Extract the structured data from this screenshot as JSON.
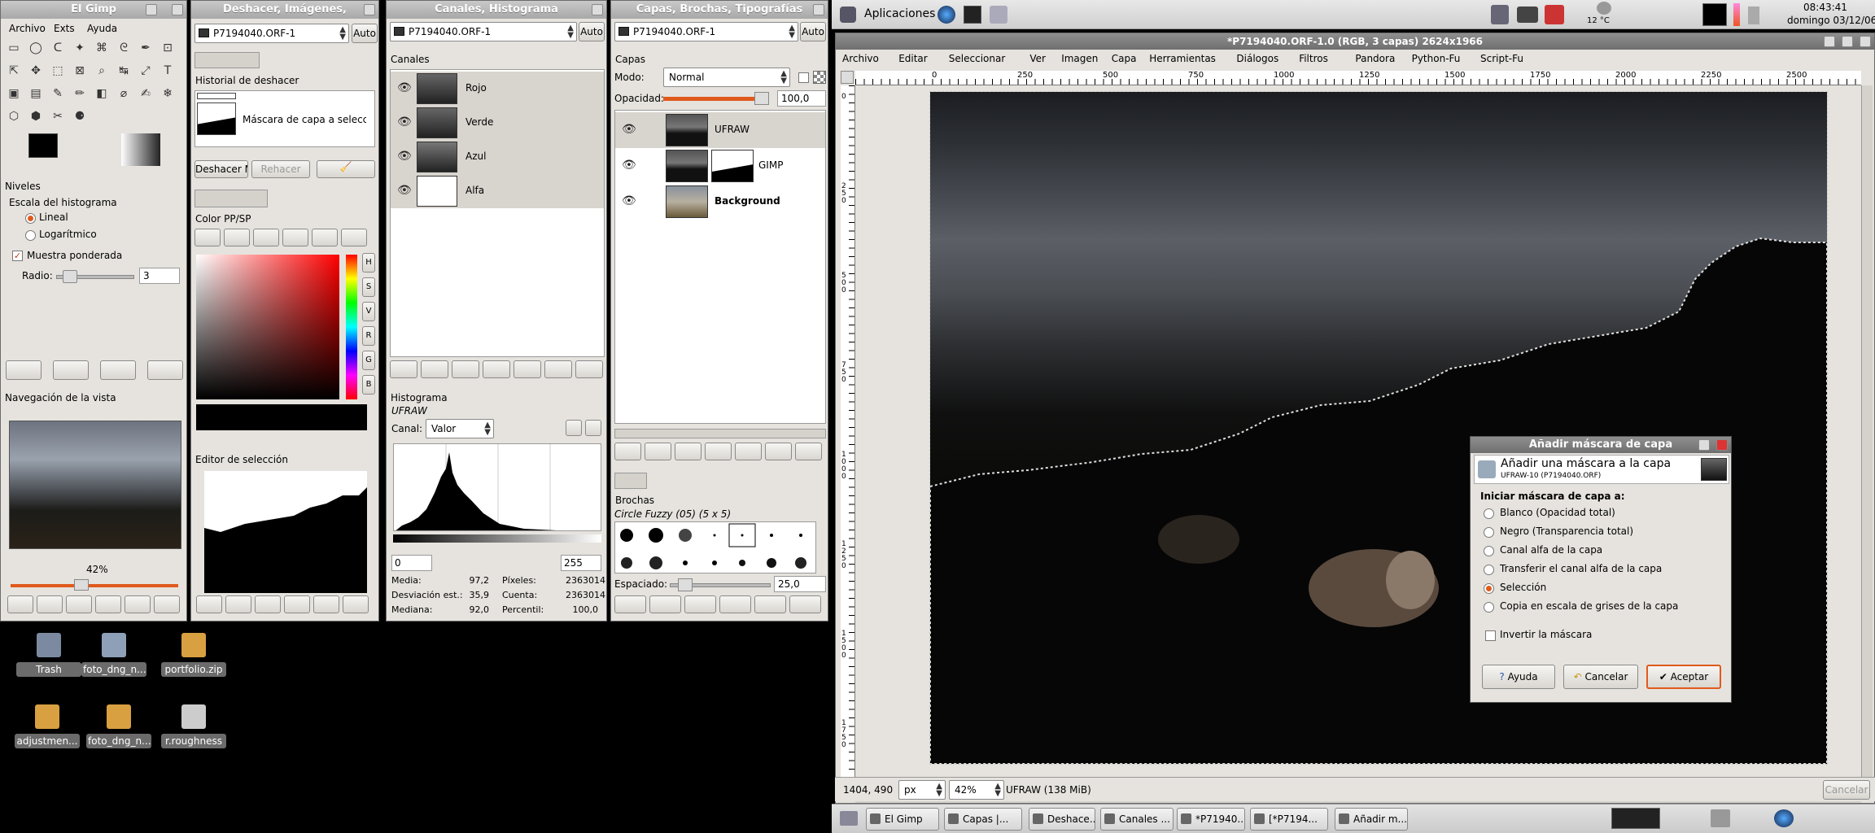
{
  "toolbox": {
    "title": "El Gimp",
    "menu": [
      "Archivo",
      "Exts",
      "Ayuda"
    ],
    "levels": {
      "title": "Niveles",
      "scale_label": "Escala del histograma",
      "linear": "Lineal",
      "log": "Logarítmico",
      "weighted": "Muestra ponderada",
      "radius_label": "Radio:",
      "radius_value": "3"
    },
    "nav": {
      "title": "Navegación de la vista",
      "zoom": "42%"
    }
  },
  "undo": {
    "title": "Deshacer, Imágenes,",
    "image": "P7194040.ORF-1",
    "auto": "Auto",
    "hist_title": "Historial de deshacer",
    "hist_item": "Máscara de capa a selección",
    "undo_btn": "Deshacer M",
    "redo_btn": "Rehacer",
    "color_title": "Color PP/SP",
    "letters": [
      "H",
      "S",
      "V",
      "R",
      "G",
      "B"
    ],
    "sel_title": "Editor de selección"
  },
  "channels": {
    "title": "Canales, Histograma",
    "image": "P7194040.ORF-1",
    "auto": "Auto",
    "section": "Canales",
    "items": [
      "Rojo",
      "Verde",
      "Azul",
      "Alfa"
    ],
    "hist": {
      "title": "Histograma",
      "layer": "UFRAW",
      "channel_label": "Canal:",
      "channel": "Valor",
      "from": "0",
      "to": "255",
      "stats": [
        [
          "Media:",
          "97,2"
        ],
        [
          "Píxeles:",
          "2363014"
        ],
        [
          "Desviación est.:",
          "35,9"
        ],
        [
          "Cuenta:",
          "2363014"
        ],
        [
          "Mediana:",
          "92,0"
        ],
        [
          "Percentil:",
          "100,0"
        ]
      ]
    }
  },
  "layers": {
    "title": "Capas, Brochas, Tipografías",
    "image": "P7194040.ORF-1",
    "auto": "Auto",
    "section": "Capas",
    "mode_label": "Modo:",
    "mode": "Normal",
    "opacity_label": "Opacidad:",
    "opacity": "100,0",
    "items": [
      "UFRAW",
      "GIMP",
      "Background"
    ],
    "brushes": {
      "title": "Brochas",
      "name": "Circle Fuzzy (05) (5 x 5)",
      "spacing_label": "Espaciado:",
      "spacing": "25,0"
    }
  },
  "panel": {
    "apps": "Aplicaciones",
    "temp": "12 °C",
    "time": "08:43:41",
    "date": "domingo 03/12/06"
  },
  "image": {
    "title": "*P7194040.ORF-1.0 (RGB, 3 capas) 2624x1966",
    "menu": [
      "Archivo",
      "Editar",
      "Seleccionar",
      "Ver",
      "Imagen",
      "Capa",
      "Herramientas",
      "Diálogos",
      "Filtros",
      "Pandora",
      "Python-Fu",
      "Script-Fu"
    ],
    "ruler": [
      "0",
      "250",
      "500",
      "750",
      "1000",
      "1250",
      "1500",
      "1750",
      "2000",
      "2250",
      "2500"
    ],
    "vruler": [
      "0",
      "2 5 0",
      "5 0 0",
      "7 5 0",
      "1 0 0 0",
      "1 2 5 0",
      "1 5 0 0",
      "1 7 5 0"
    ],
    "status": {
      "coords": "1404, 490",
      "unit": "px",
      "zoom": "42%",
      "info": "UFRAW (138 MiB)",
      "cancel": "Cancelar"
    }
  },
  "dialog": {
    "title": "Añadir máscara de capa",
    "heading": "Añadir una máscara a la capa",
    "sub": "UFRAW-10 (P7194040.ORF)",
    "init": "Iniciar máscara de capa a:",
    "options": [
      "Blanco (Opacidad total)",
      "Negro (Transparencia total)",
      "Canal alfa de la capa",
      "Transferir el canal alfa de la capa",
      "Selección",
      "Copia en escala de grises de la capa"
    ],
    "selected": 4,
    "invert": "Invertir la máscara",
    "help": "Ayuda",
    "cancel": "Cancelar",
    "ok": "Aceptar"
  },
  "desktop": [
    "Trash",
    "foto_dng_n...",
    "portfolio.zip",
    "adjustmen...",
    "foto_dng_n...",
    "r.roughness"
  ],
  "taskbar": [
    "El Gimp",
    "Capas |...",
    "Deshace...",
    "Canales ...",
    "*P71940...",
    "[*P7194...",
    "Añadir m..."
  ]
}
